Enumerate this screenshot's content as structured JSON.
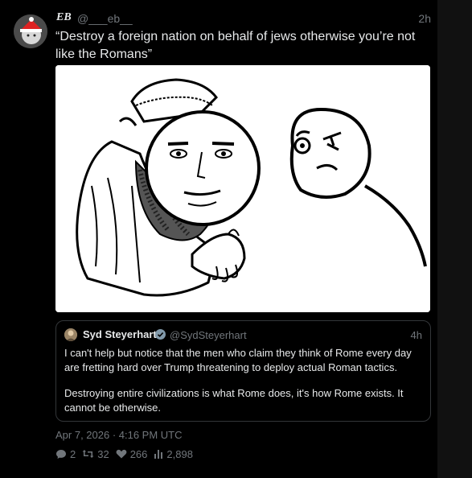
{
  "tweet": {
    "author_name": "EB",
    "author_handle": "@___eb__",
    "relative_time": "2h",
    "text": "“Destroy a foreign nation on behalf of jews otherwise you’re not like the Romans”",
    "timestamp": "Apr 7, 2026 · 4:16 PM UTC",
    "stats": {
      "replies": "2",
      "retweets": "32",
      "likes": "266",
      "views": "2,898"
    }
  },
  "quoted": {
    "author_name": "Syd Steyerhart",
    "author_handle": "@SydSteyerhart",
    "relative_time": "4h",
    "paragraphs": [
      "I can't help but notice that the men who claim they think of Rome every day are fretting hard over Trump threatening to deploy actual Roman tactics.",
      "Destroying entire civilizations is what Rome does, it's how Rome exists. It cannot be otherwise."
    ]
  },
  "icons": {
    "reply": "reply-icon",
    "retweet": "retweet-icon",
    "like": "heart-icon",
    "views": "bar-chart-icon",
    "verified": "verified-badge-icon"
  },
  "colors": {
    "background": "#000000",
    "text": "#e7e9ea",
    "muted": "#71767b",
    "border": "#333639",
    "verified": "#829aab"
  }
}
